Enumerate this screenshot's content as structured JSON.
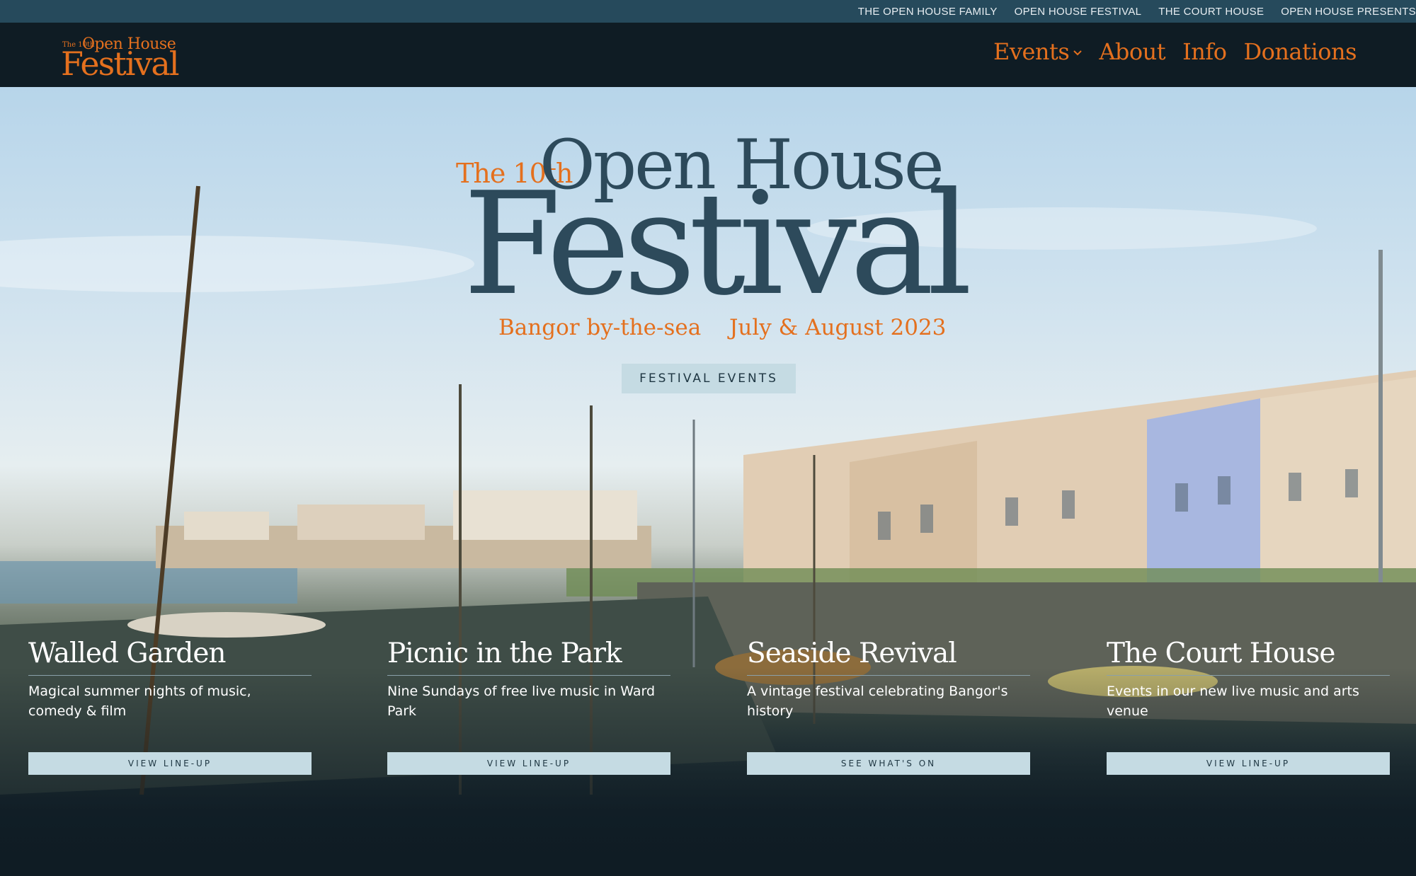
{
  "topbar": {
    "family": "THE OPEN HOUSE FAMILY",
    "links": [
      "OPEN HOUSE FESTIVAL",
      "THE COURT HOUSE",
      "OPEN HOUSE PRESENTS"
    ]
  },
  "logo": {
    "the": "The 10th",
    "open_house": "Open House",
    "festival": "Festival"
  },
  "nav": {
    "events": "Events",
    "about": "About",
    "info": "Info",
    "donations": "Donations"
  },
  "hero": {
    "the_10th": "The 10th",
    "open_house": "Open House",
    "festival": "Festival",
    "location": "Bangor by-the-sea",
    "dates": "July & August 2023",
    "cta": "FESTIVAL EVENTS"
  },
  "cards": [
    {
      "title": "Walled Garden",
      "desc": "Magical summer nights of music, comedy & film",
      "button": "VIEW LINE-UP"
    },
    {
      "title": "Picnic in the Park",
      "desc": "Nine Sundays of free live music in Ward Park",
      "button": "VIEW LINE-UP"
    },
    {
      "title": "Seaside Revival",
      "desc": "A vintage festival celebrating Bangor's history",
      "button": "SEE WHAT'S ON"
    },
    {
      "title": "The Court House",
      "desc": "Events in our new live music and arts venue",
      "button": "VIEW LINE-UP"
    }
  ],
  "colors": {
    "orange": "#e4701e",
    "navy": "#2d4a5b",
    "dark": "#0f1c24",
    "bar": "#264a5c",
    "button": "#c5dbe3"
  }
}
